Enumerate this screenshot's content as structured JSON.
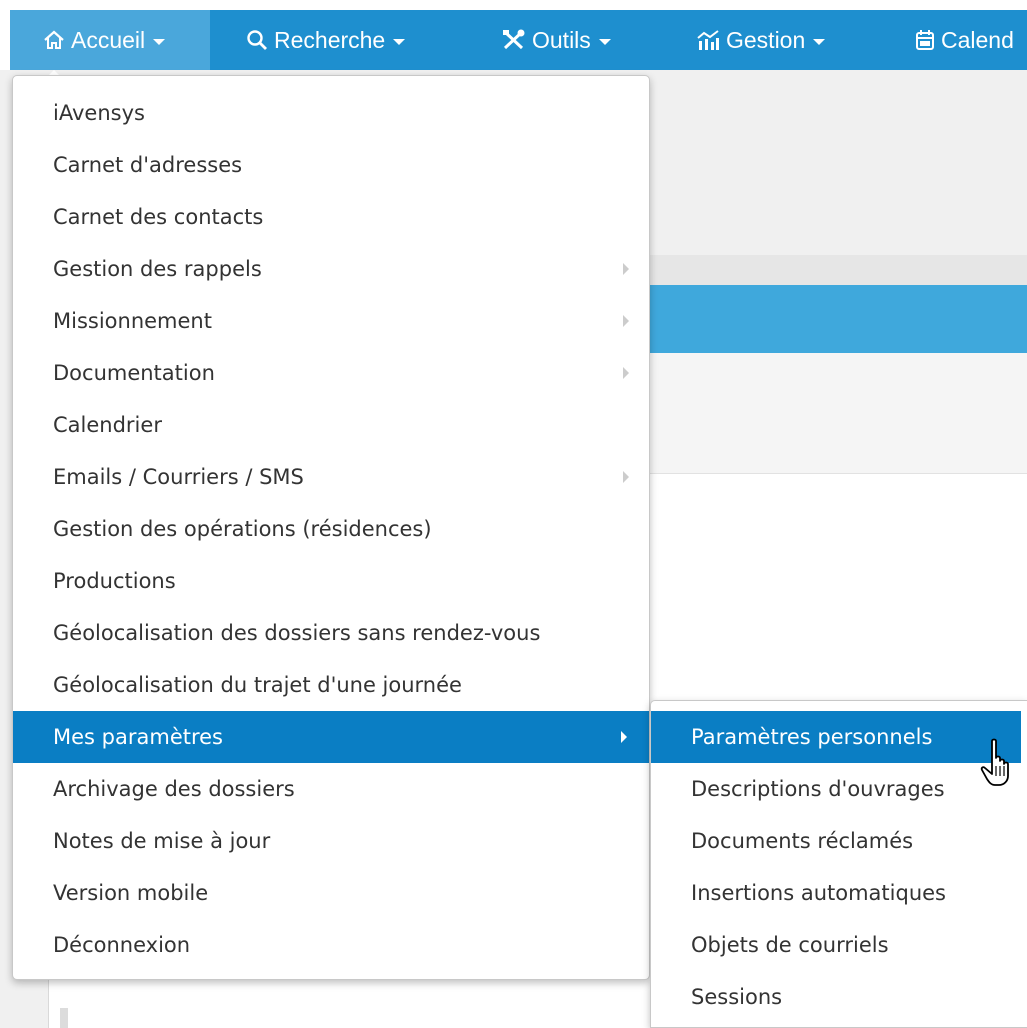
{
  "nav": [
    {
      "label": "Accueil",
      "icon": "home-icon"
    },
    {
      "label": "Recherche",
      "icon": "search-icon"
    },
    {
      "label": "Outils",
      "icon": "tools-icon"
    },
    {
      "label": "Gestion",
      "icon": "chart-icon"
    },
    {
      "label": "Calend",
      "icon": "calendar-icon"
    }
  ],
  "menu": {
    "items": [
      {
        "label": "iAvensys",
        "has_submenu": false
      },
      {
        "label": "Carnet d'adresses",
        "has_submenu": false
      },
      {
        "label": "Carnet des contacts",
        "has_submenu": false
      },
      {
        "label": "Gestion des rappels",
        "has_submenu": true
      },
      {
        "label": "Missionnement",
        "has_submenu": true
      },
      {
        "label": "Documentation",
        "has_submenu": true
      },
      {
        "label": "Calendrier",
        "has_submenu": false
      },
      {
        "label": "Emails / Courriers / SMS",
        "has_submenu": true
      },
      {
        "label": "Gestion des opérations (résidences)",
        "has_submenu": false
      },
      {
        "label": "Productions",
        "has_submenu": false
      },
      {
        "label": "Géolocalisation des dossiers sans rendez-vous",
        "has_submenu": false
      },
      {
        "label": "Géolocalisation du trajet d'une journée",
        "has_submenu": false
      },
      {
        "label": "Mes paramètres",
        "has_submenu": true,
        "active": true
      },
      {
        "label": "Archivage des dossiers",
        "has_submenu": false
      },
      {
        "label": "Notes de mise à jour",
        "has_submenu": false
      },
      {
        "label": "Version mobile",
        "has_submenu": false
      },
      {
        "label": "Déconnexion",
        "has_submenu": false
      }
    ]
  },
  "submenu": {
    "items": [
      {
        "label": "Paramètres personnels",
        "active": true
      },
      {
        "label": "Descriptions d'ouvrages"
      },
      {
        "label": "Documents réclamés"
      },
      {
        "label": "Insertions automatiques"
      },
      {
        "label": "Objets de courriels"
      },
      {
        "label": "Sessions"
      }
    ]
  },
  "colors": {
    "navbar": "#1e8fcf",
    "nav_active": "#4aa7db",
    "menu_active": "#0a7ec4",
    "text": "#333333"
  }
}
